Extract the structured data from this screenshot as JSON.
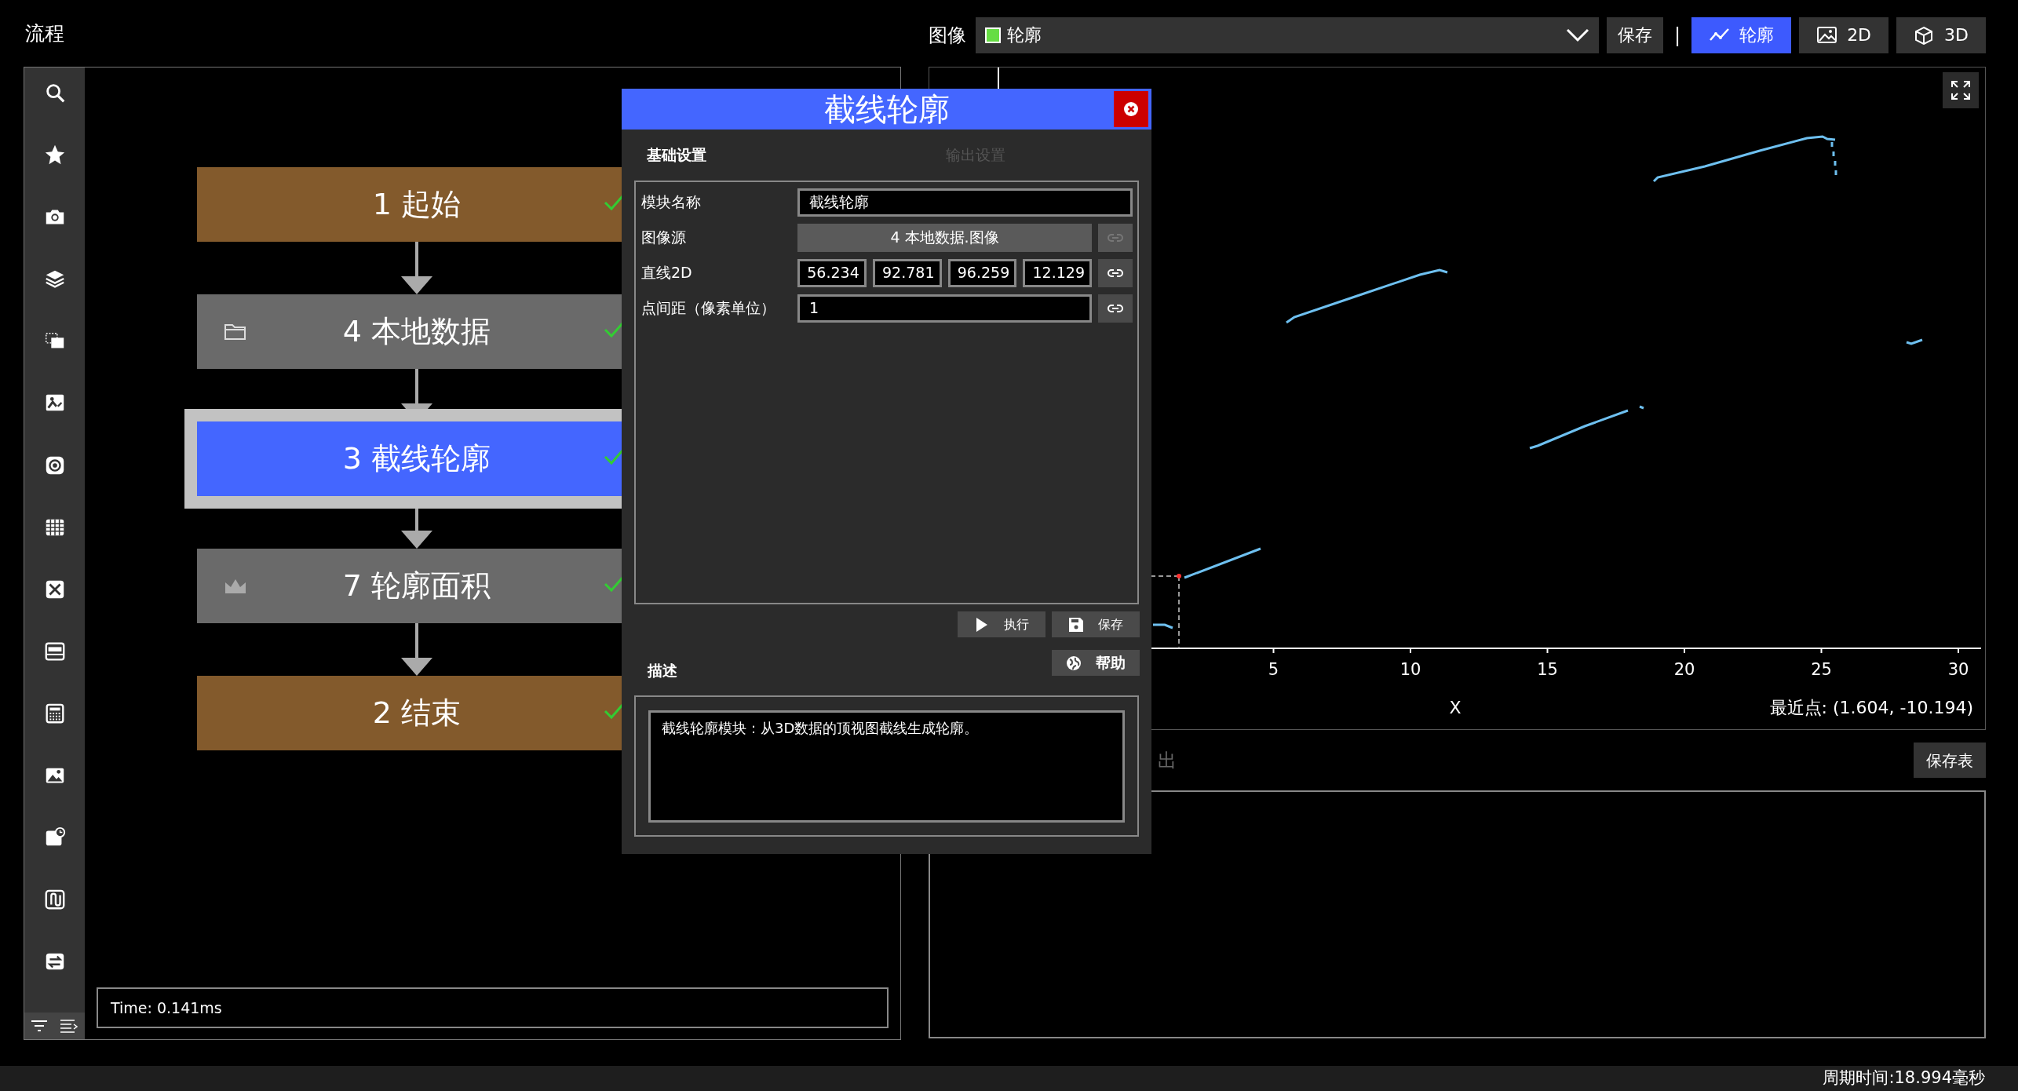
{
  "flow_panel": {
    "title": "流程",
    "nodes": [
      {
        "label": "1 起始",
        "kind": "start",
        "selected": false,
        "done": true
      },
      {
        "label": "4 本地数据",
        "kind": "input",
        "selected": false,
        "done": true
      },
      {
        "label": "3 截线轮廓",
        "kind": "process",
        "selected": true,
        "done": true
      },
      {
        "label": "7 轮廓面积",
        "kind": "measure",
        "selected": false,
        "done": true
      },
      {
        "label": "2 结束",
        "kind": "end",
        "selected": false,
        "done": true
      }
    ],
    "time": "Time: 0.141ms"
  },
  "image_panel": {
    "label": "图像",
    "dropdown": {
      "value": "轮廓",
      "color": "#66dd44"
    },
    "save_button": "保存",
    "separator": "|",
    "view_tabs": [
      {
        "label": "轮廓",
        "kind": "profile",
        "selected": true
      },
      {
        "label": "2D",
        "kind": "planar",
        "selected": false
      },
      {
        "label": "3D",
        "kind": "volume",
        "selected": false
      }
    ],
    "x_ticks": [
      "5",
      "10",
      "15",
      "20",
      "25",
      "30"
    ],
    "x_label": "X",
    "nearest_point": "最近点: (1.604, -10.194)"
  },
  "output_panel": {
    "title": "出",
    "save_button": "保存表"
  },
  "dialog": {
    "title": "截线轮廓",
    "tabs": [
      {
        "label": "基础设置",
        "selected": true
      },
      {
        "label": "输出设置",
        "selected": false
      }
    ],
    "fields": [
      {
        "label": "模块名称",
        "kind": "text",
        "value": "截线轮廓"
      },
      {
        "label": "图像源",
        "kind": "source",
        "value": "4 本地数据.图像",
        "link_enabled": false
      },
      {
        "label": "直线2D",
        "kind": "multi",
        "values": [
          "56.234",
          "92.781",
          "96.259",
          "12.129"
        ],
        "link_enabled": true
      },
      {
        "label": "点间距（像素单位）",
        "kind": "text",
        "value": "1",
        "link_enabled": true
      }
    ],
    "actions": [
      {
        "label": "执行",
        "kind": "run"
      },
      {
        "label": "保存",
        "kind": "save"
      }
    ],
    "description_title": "描述",
    "help_button": "帮助",
    "description": "截线轮廓模块：从3D数据的顶视图截线生成轮廓。"
  },
  "status_bar": "周期时间:18.994毫秒"
}
